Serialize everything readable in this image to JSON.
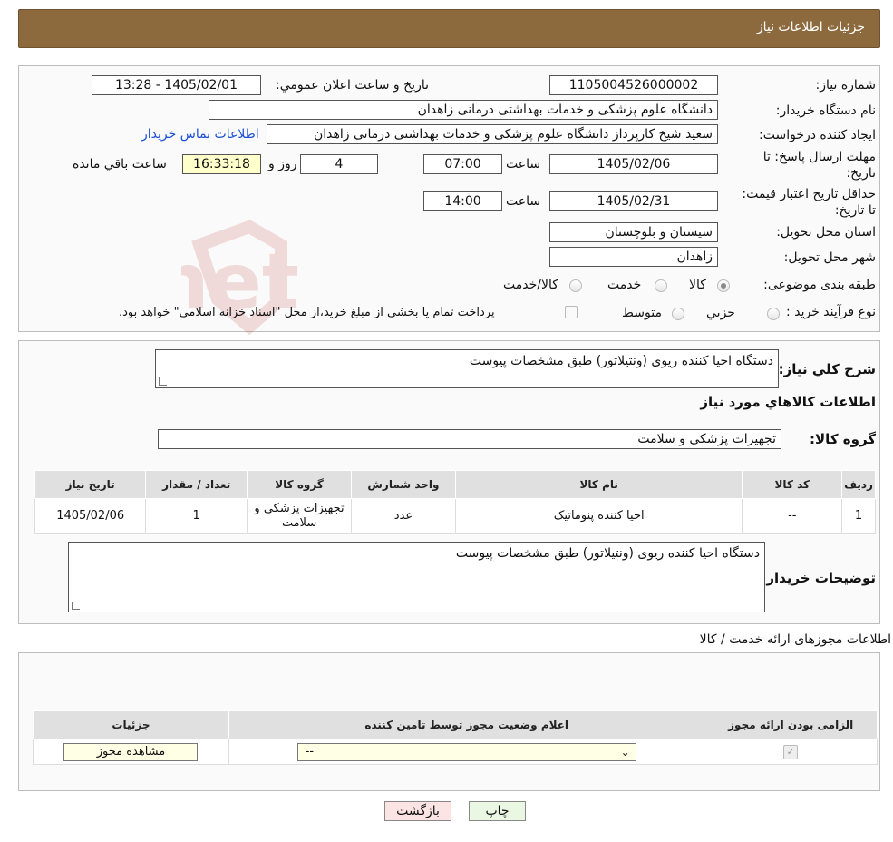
{
  "header": {
    "title": "جزئیات اطلاعات نیاز"
  },
  "watermark": {
    "text": "AriaTender.net"
  },
  "details": {
    "need_number_label": "شماره نیاز:",
    "need_number": "1105004526000002",
    "announce_label": "تاریخ و ساعت اعلان عمومي:",
    "announce_value": "1405/02/01 - 13:28",
    "buyer_org_label": "نام دستگاه خريدار:",
    "buyer_org": "دانشگاه علوم پزشکی و خدمات بهداشتی درمانی زاهدان",
    "creator_label": "ايجاد کننده درخواست:",
    "creator": "سعید شیخ کارپرداز دانشگاه علوم پزشکی و خدمات بهداشتی درمانی زاهدان",
    "contact_link": "اطلاعات تماس خريدار",
    "deadline_label": "مهلت ارسال پاسخ: تا تاريخ:",
    "deadline_date": "1405/02/06",
    "time_label": "ساعت",
    "deadline_time": "07:00",
    "days": "4",
    "days_label": "روز و",
    "remaining_time": "16:33:18",
    "remaining_label": "ساعت باقي مانده",
    "validity_label": "حداقل تاريخ اعتبار قيمت: تا تاريخ:",
    "validity_date": "1405/02/31",
    "validity_time": "14:00",
    "province_label": "استان محل تحويل:",
    "province": "سيستان و بلوچستان",
    "city_label": "شهر محل تحويل:",
    "city": "زاهدان",
    "category_label": "طبقه بندی موضوعی:",
    "category_options": [
      "کالا",
      "خدمت",
      "کالا/خدمت"
    ],
    "process_label": "نوع فرآيند خريد :",
    "process_options": [
      "جزيي",
      "متوسط"
    ],
    "process_note": "پرداخت تمام یا بخشی از مبلغ خرید،از محل \"اسناد خزانه اسلامی\" خواهد بود."
  },
  "goods": {
    "summary_label": "شرح کلي نياز:",
    "summary": "دستگاه احیا کننده ریوی (ونتیلاتور) طبق مشخصات پیوست",
    "section_title": "اطلاعات کالاهاي مورد نياز",
    "group_label": "گروه کالا:",
    "group": "تجهیزات پزشکی و سلامت",
    "columns": [
      "رديف",
      "کد کالا",
      "نام کالا",
      "واحد شمارش",
      "گروه کالا",
      "تعداد / مقدار",
      "تاريخ نياز"
    ],
    "rows": [
      [
        "1",
        "--",
        "احیا کننده پنوماتیک",
        "عدد",
        "تجهیزات پزشکی و سلامت",
        "1",
        "1405/02/06"
      ]
    ],
    "buyer_notes_label": "توضيحات خريدار:",
    "buyer_notes": "دستگاه احیا کننده ریوی (ونتیلاتور) طبق مشخصات پیوست"
  },
  "permits": {
    "title": "اطلاعات مجوزهای ارائه خدمت / کالا",
    "columns": [
      "الزامی بودن ارائه مجوز",
      "اعلام وضعيت مجوز توسط تامين کننده",
      "جزئيات"
    ],
    "select_value": "--",
    "view_button": "مشاهده مجوز"
  },
  "footer": {
    "print_button": "چاپ",
    "back_button": "بازگشت"
  }
}
